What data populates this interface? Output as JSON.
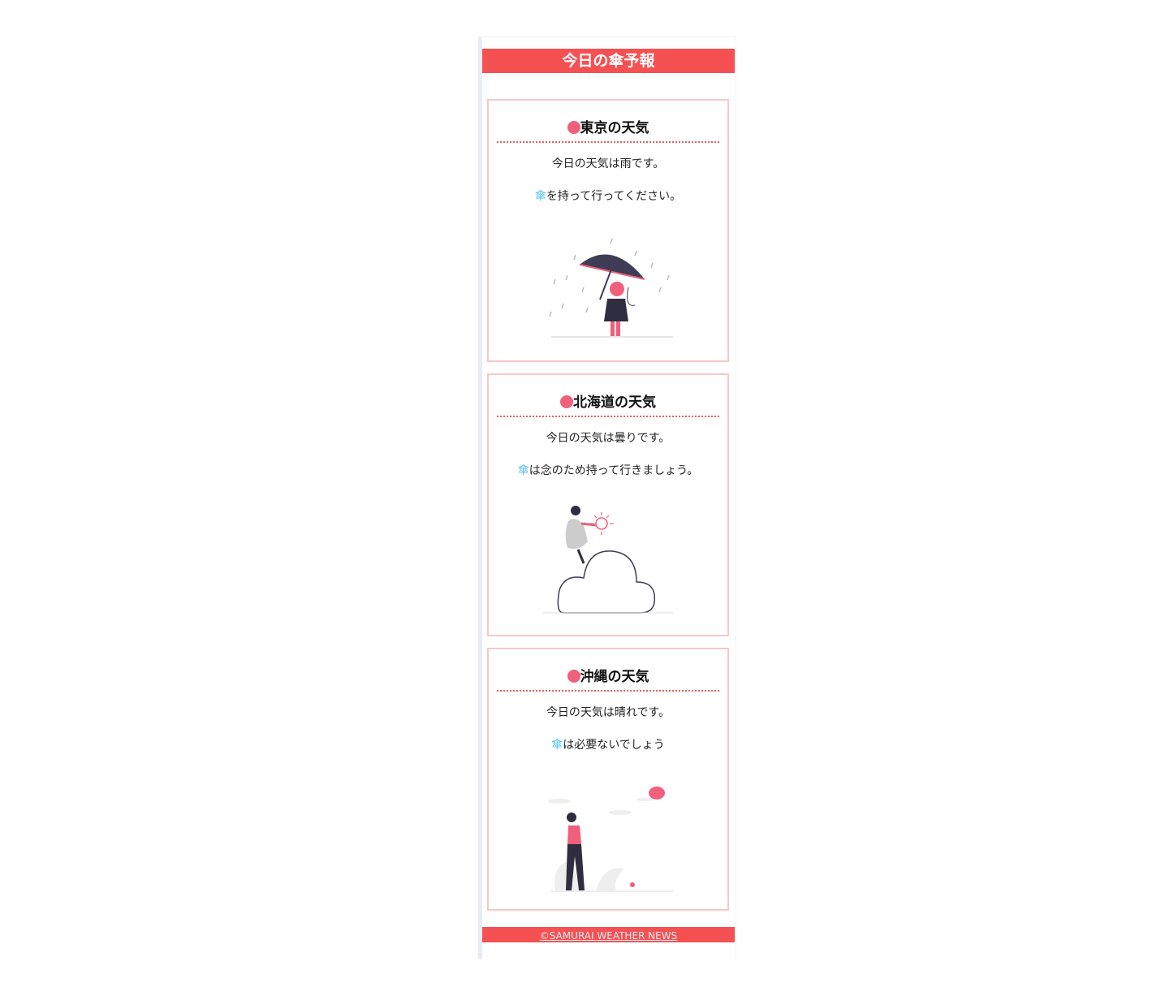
{
  "header": {
    "title": "今日の傘予報"
  },
  "cards": [
    {
      "title": "東京の天気",
      "line1": "今日の天気は雨です。",
      "umbrella": "傘",
      "line2": "を持って行ってください。",
      "illustration": "rain-umbrella-girl"
    },
    {
      "title": "北海道の天気",
      "line1": "今日の天気は曇りです。",
      "umbrella": "傘",
      "line2": "は念のため持って行きましょう。",
      "illustration": "cloud-sun-girl"
    },
    {
      "title": "沖縄の天気",
      "line1": "今日の天気は晴れです。",
      "umbrella": "傘",
      "line2": "は必要ないでしょう",
      "illustration": "sunny-walk-girl"
    }
  ],
  "footer": {
    "link": "©SAMURAI WEATHER NEWS"
  },
  "colors": {
    "accent": "#f55052",
    "dot": "#f0607a",
    "umbrella": "#4fc0f0"
  }
}
